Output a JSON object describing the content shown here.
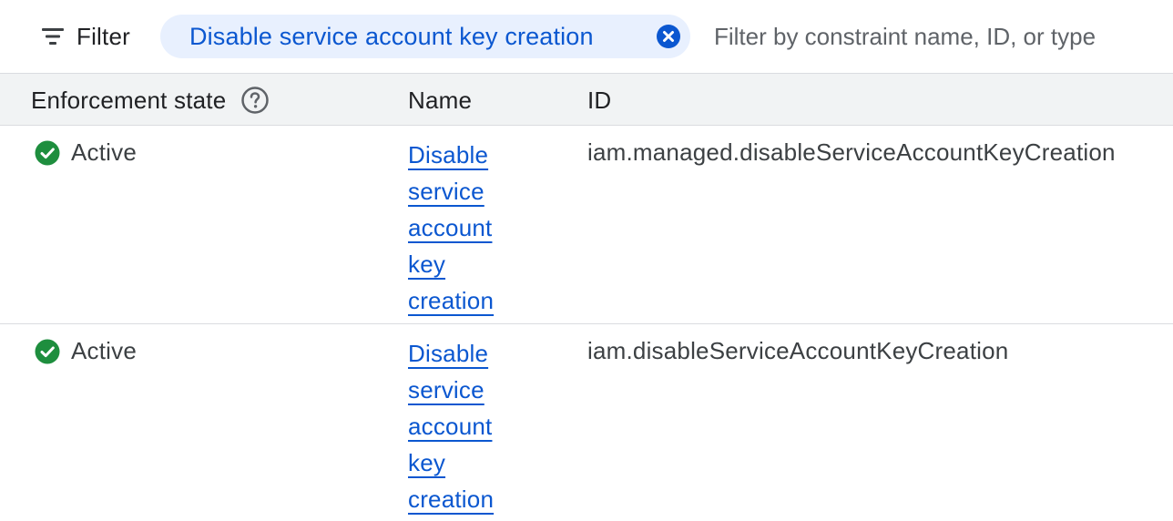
{
  "filter_bar": {
    "filter_label": "Filter",
    "chip_label": "Disable service account key creation",
    "search_placeholder": "Filter by constraint name, ID, or type",
    "search_value": ""
  },
  "table": {
    "columns": {
      "state": "Enforcement state",
      "name": "Name",
      "id": "ID"
    },
    "rows": [
      {
        "state": "Active",
        "name": "Disable service account key creation",
        "id": "iam.managed.disableServiceAccountKeyCreation"
      },
      {
        "state": "Active",
        "name": "Disable service account key creation",
        "id": "iam.disableServiceAccountKeyCreation"
      }
    ]
  },
  "colors": {
    "link": "#0b57d0",
    "chip_bg": "#e8f0fe",
    "header_bg": "#f1f3f4",
    "active_green": "#1e8e3e"
  },
  "icons": {
    "filter": "filter-lines-icon",
    "chip_close": "close-circle-icon",
    "help": "help-circle-icon",
    "status": "check-circle-icon"
  }
}
